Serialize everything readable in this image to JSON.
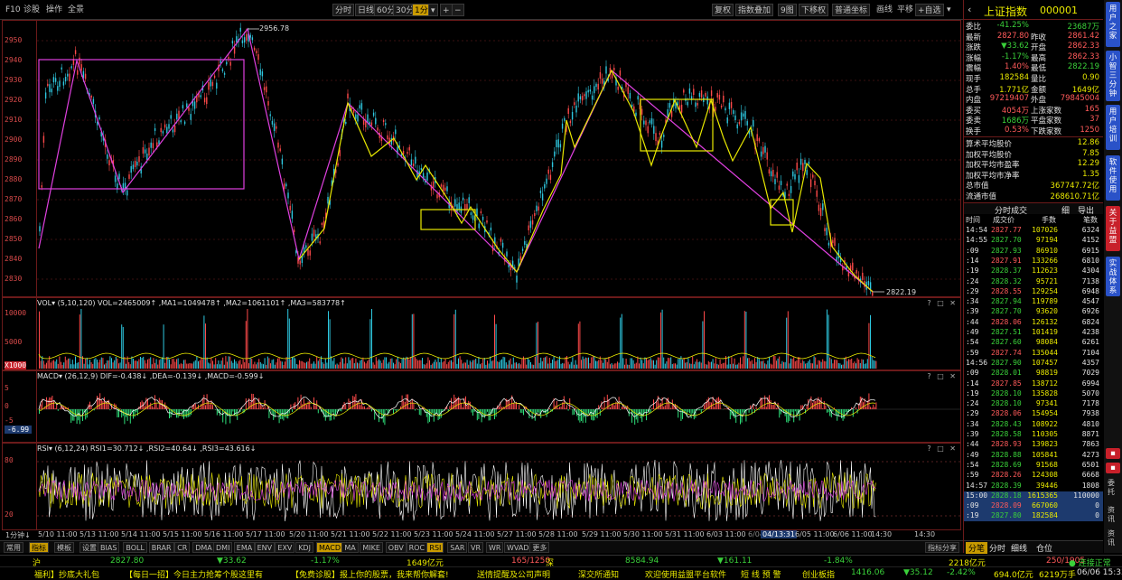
{
  "toolbar": {
    "left": [
      "F10",
      "诊股",
      "操作",
      "全景"
    ],
    "periods": [
      "分时",
      "日线",
      "60分",
      "30分",
      "1分"
    ],
    "period_active": "1分",
    "right": [
      "复权",
      "指数叠加",
      "9图",
      "下移权",
      "普通坐标",
      "画线",
      "平移",
      "+自选"
    ]
  },
  "price_axis": [
    "2950",
    "2940",
    "2930",
    "2920",
    "2910",
    "2900",
    "2890",
    "2880",
    "2870",
    "2860",
    "2850",
    "2840",
    "2830"
  ],
  "price_marks": {
    "high": "2956.78",
    "low": "2822.19"
  },
  "vol": {
    "title": "VOL▾ (5,10,120)  VOL=2465009↑ ,MA1=1049478↑ ,MA2=1061101↑ ,MA3=583778↑",
    "ticks": [
      "10000",
      "5000",
      "0",
      "X1000"
    ]
  },
  "macd": {
    "title": "MACD▾ (26,12,9)  DIF=-0.438↓ ,DEA=-0.139↓ ,MACD=-0.599↓",
    "ticks": [
      "5",
      "0",
      "-5"
    ],
    "badge": "-6.99"
  },
  "rsi": {
    "title": "RSI▾ (6,12,24)  RSI1=30.712↓ ,RSI2=40.64↓ ,RSI3=43.616↓",
    "ticks": [
      "80",
      "20"
    ]
  },
  "xaxis": [
    "1分钟↓",
    "5/10 11:00",
    "5/13 11:00",
    "5/14 11:00",
    "5/15 11:00",
    "5/16 11:00",
    "5/17 11:00",
    "5/20 11:00",
    "5/21 11:00",
    "5/22 11:00",
    "5/23 11:00",
    "5/24 11:00",
    "5/27 11:00",
    "5/28 11:00",
    "5/29 11:00",
    "5/30 11:00",
    "5/31 11:00",
    "6/03 11:00",
    "6/04 11:00",
    "04/13:31",
    "6/05 11:00",
    "6/06 11:00",
    "14:30",
    "14:30"
  ],
  "indicators": [
    "常用",
    "指标",
    "模板",
    "设置",
    "BIAS",
    "BOLL",
    "BRAR",
    "CR",
    "DMA",
    "DMI",
    "EMA",
    "ENV",
    "EXV",
    "KDJ",
    "MACD",
    "MA",
    "MIKE",
    "OBV",
    "ROC",
    "RSI",
    "SAR",
    "VR",
    "WR",
    "WVAD",
    "更多"
  ],
  "indicators_selected": [
    "MACD",
    "RSI"
  ],
  "share_btn": "指标分享",
  "quote": {
    "title": "上证指数",
    "code": "000001",
    "rows": [
      [
        "委比",
        "-41.25%",
        "",
        "23687万"
      ],
      [
        "最新",
        "2827.80",
        "昨收",
        "2861.42"
      ],
      [
        "涨跌",
        "▼33.62",
        "开盘",
        "2862.33"
      ],
      [
        "涨幅",
        "-1.17%",
        "最高",
        "2862.33"
      ],
      [
        "震幅",
        "1.40%",
        "最低",
        "2822.19"
      ],
      [
        "现手",
        "182584",
        "量比",
        "0.90"
      ],
      [
        "总手",
        "1.771亿",
        "金额",
        "1649亿"
      ],
      [
        "内盘",
        "97219407",
        "外盘",
        "79845004"
      ],
      [
        "委买",
        "4054万",
        "上涨家数",
        "165"
      ],
      [
        "委卖",
        "1686万",
        "平盘家数",
        "37"
      ],
      [
        "换手",
        "0.53%",
        "下跌家数",
        "1250"
      ]
    ],
    "stats": [
      [
        "算术平均股价",
        "12.86"
      ],
      [
        "加权平均股价",
        "7.85"
      ],
      [
        "加权平均市盈率",
        "12.29"
      ],
      [
        "加权平均市净率",
        "1.35"
      ],
      [
        "总市值",
        "367747.72亿"
      ],
      [
        "流通市值",
        "268610.71亿"
      ]
    ]
  },
  "trades": {
    "title": "分时成交",
    "tools": [
      "细",
      "导出"
    ],
    "headers": [
      "时间",
      "成交价",
      "手数",
      "笔数"
    ],
    "rows": [
      [
        "14:54",
        "2827.77",
        "107026",
        "6324"
      ],
      [
        "14:55",
        "2827.70",
        "97194",
        "4152"
      ],
      [
        ":09",
        "2827.93",
        "86910",
        "6915"
      ],
      [
        ":14",
        "2827.91",
        "133266",
        "6810"
      ],
      [
        ":19",
        "2828.37",
        "112623",
        "4304"
      ],
      [
        ":24",
        "2828.32",
        "95721",
        "7138"
      ],
      [
        ":29",
        "2828.55",
        "129254",
        "6948"
      ],
      [
        ":34",
        "2827.94",
        "119789",
        "4547"
      ],
      [
        ":39",
        "2827.70",
        "93620",
        "6926"
      ],
      [
        ":44",
        "2828.06",
        "126132",
        "6824"
      ],
      [
        ":49",
        "2827.51",
        "101419",
        "4238"
      ],
      [
        ":54",
        "2827.60",
        "98084",
        "6261"
      ],
      [
        ":59",
        "2827.74",
        "135044",
        "7104"
      ],
      [
        "14:56",
        "2827.90",
        "107457",
        "4357"
      ],
      [
        ":09",
        "2828.01",
        "98819",
        "7029"
      ],
      [
        ":14",
        "2827.85",
        "138712",
        "6994"
      ],
      [
        ":19",
        "2828.10",
        "135828",
        "5070"
      ],
      [
        ":24",
        "2828.10",
        "97341",
        "7178"
      ],
      [
        ":29",
        "2828.06",
        "154954",
        "7938"
      ],
      [
        ":34",
        "2828.43",
        "108922",
        "4810"
      ],
      [
        ":39",
        "2828.58",
        "110305",
        "8871"
      ],
      [
        ":44",
        "2828.93",
        "139823",
        "7863"
      ],
      [
        ":49",
        "2828.88",
        "105841",
        "4273"
      ],
      [
        ":54",
        "2828.69",
        "91568",
        "6501"
      ],
      [
        ":59",
        "2828.26",
        "124308",
        "6668"
      ],
      [
        "14:57",
        "2828.39",
        "39446",
        "1808"
      ],
      [
        "15:00",
        "2828.18",
        "1615365",
        "110000"
      ],
      [
        ":09",
        "2828.09",
        "667060",
        "0"
      ],
      [
        ":19",
        "2827.80",
        "182584",
        "0"
      ]
    ],
    "bottom_tabs": [
      "分笔",
      "分时",
      "细线",
      "仓位"
    ]
  },
  "side_tabs": [
    "用户之家",
    "小智三分钟",
    "用户培训",
    "软件使用",
    "关于益盟",
    "实战体系"
  ],
  "side_tabs_bottom": [
    "委托",
    "资讯",
    "资讯"
  ],
  "ticker1": [
    {
      "t": "沪",
      "c": "yel"
    },
    {
      "t": "2827.80",
      "c": "grn"
    },
    {
      "t": "▼33.62",
      "c": "grn"
    },
    {
      "t": "-1.17%",
      "c": "grn"
    },
    {
      "t": "1649亿元",
      "c": "yel"
    },
    {
      "t": "165/1250",
      "c": "red"
    },
    {
      "t": "深",
      "c": "yel"
    },
    {
      "t": "8584.94",
      "c": "grn"
    },
    {
      "t": "▼161.11",
      "c": "grn"
    },
    {
      "t": "-1.84%",
      "c": "grn"
    },
    {
      "t": "2218亿元",
      "c": "yel"
    },
    {
      "t": "250/1905",
      "c": "red"
    },
    {
      "t": "● 连接正常",
      "c": "grn"
    }
  ],
  "ticker2": [
    {
      "t": "福利】抄底大礼包",
      "c": "yel"
    },
    {
      "t": "【每日一招】今日主力抢筹个股这里有",
      "c": "yel"
    },
    {
      "t": "【免费诊股】报上你的股票，我来帮你解套!",
      "c": "yel"
    },
    {
      "t": "送情提醒及公司声明",
      "c": "yel"
    },
    {
      "t": "深交所通知",
      "c": "yel"
    },
    {
      "t": "欢迎使用益盟平台软件",
      "c": "yel"
    },
    {
      "t": "短 线 预 警",
      "c": "yel"
    },
    {
      "t": "创业板指",
      "c": "yel"
    },
    {
      "t": "1416.06",
      "c": "grn"
    },
    {
      "t": "▼35.12",
      "c": "grn"
    },
    {
      "t": "-2.42%",
      "c": "grn"
    },
    {
      "t": "694.0亿元",
      "c": "yel"
    },
    {
      "t": "6219万手",
      "c": "yel"
    },
    {
      "t": "06/06 15:33",
      "c": "wht"
    }
  ],
  "colors": {
    "up": "#ff5a5a",
    "down": "#3ad13a",
    "accent": "#c89a00",
    "pane_border": "#6b1a1a"
  }
}
